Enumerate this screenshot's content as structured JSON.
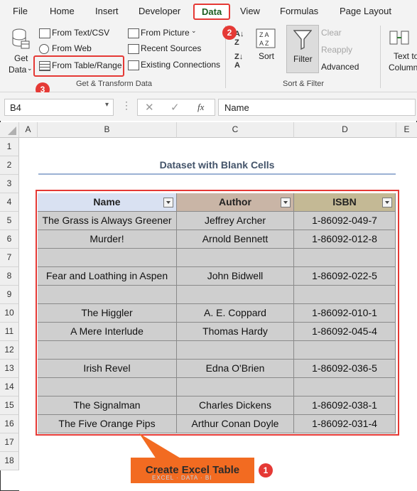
{
  "menu": [
    "File",
    "Home",
    "Insert",
    "Developer",
    "Data",
    "View",
    "Formulas",
    "Page Layout"
  ],
  "ribbon": {
    "get_data": [
      "Get",
      "Data"
    ],
    "from_text_csv": "From Text/CSV",
    "from_web": "From Web",
    "from_table_range": "From Table/Range",
    "from_picture": "From Picture",
    "recent_sources": "Recent Sources",
    "existing_connections": "Existing Connections",
    "group_get_transform": "Get & Transform Data",
    "sort": "Sort",
    "filter": "Filter",
    "clear": "Clear",
    "reapply": "Reapply",
    "advanced": "Advanced",
    "group_sort_filter": "Sort & Filter",
    "text_to_columns": [
      "Text to",
      "Column"
    ]
  },
  "badges": {
    "one": "1",
    "two": "2",
    "three": "3"
  },
  "formula_bar": {
    "name_box": "B4",
    "fx": "fx",
    "value": "Name"
  },
  "columns": [
    "A",
    "B",
    "C",
    "D",
    "E"
  ],
  "rows": [
    "1",
    "2",
    "3",
    "4",
    "5",
    "6",
    "7",
    "8",
    "9",
    "10",
    "11",
    "12",
    "13",
    "14",
    "15",
    "16",
    "17",
    "18"
  ],
  "sheet_title": "Dataset with Blank Cells",
  "table": {
    "headers": [
      "Name",
      "Author",
      "ISBN"
    ],
    "header_colors": [
      "#d9e1f2",
      "#c9b5a6",
      "#c4b995"
    ],
    "rows": [
      [
        "The Grass is Always Greener",
        "Jeffrey Archer",
        "1-86092-049-7"
      ],
      [
        "Murder!",
        "Arnold Bennett",
        "1-86092-012-8"
      ],
      [
        "",
        "",
        ""
      ],
      [
        "Fear and Loathing in Aspen",
        "John Bidwell",
        "1-86092-022-5"
      ],
      [
        "",
        "",
        ""
      ],
      [
        "The Higgler",
        "A. E. Coppard",
        "1-86092-010-1"
      ],
      [
        "A Mere Interlude",
        "Thomas Hardy",
        "1-86092-045-4"
      ],
      [
        "",
        "",
        ""
      ],
      [
        "Irish Revel",
        "Edna O'Brien",
        "1-86092-036-5"
      ],
      [
        "",
        "",
        ""
      ],
      [
        "The Signalman",
        "Charles Dickens",
        "1-86092-038-1"
      ],
      [
        "The Five Orange Pips",
        "Arthur Conan Doyle",
        "1-86092-031-4"
      ]
    ]
  },
  "callout": "Create Excel Table",
  "watermark": "EXCEL · DATA · BI",
  "accent_red": "#e53935",
  "callout_orange": "#f26b21"
}
